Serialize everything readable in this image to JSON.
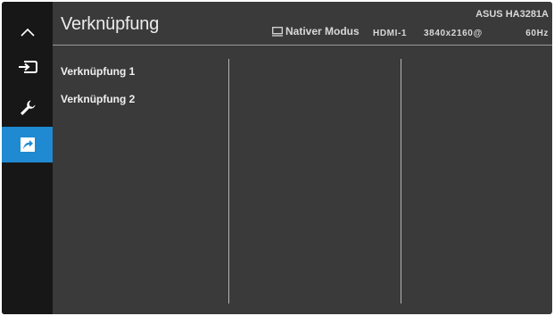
{
  "header": {
    "title": "Verknüpfung",
    "model": "ASUS HA3281A",
    "mode": "Nativer Modus",
    "input": "HDMI-1",
    "resolution": "3840x2160@",
    "refresh": "60Hz"
  },
  "sidebar": {
    "items": [
      {
        "icon": "chevron-up-icon"
      },
      {
        "icon": "input-select-icon"
      },
      {
        "icon": "wrench-icon"
      },
      {
        "icon": "shortcut-arrow-icon",
        "active": true
      }
    ]
  },
  "menu": {
    "items": [
      {
        "label": "Verknüpfung 1"
      },
      {
        "label": "Verknüpfung 2"
      }
    ]
  },
  "colors": {
    "accent": "#1f8ad1",
    "panel": "#3a3a3a",
    "sidebar": "#171717"
  }
}
